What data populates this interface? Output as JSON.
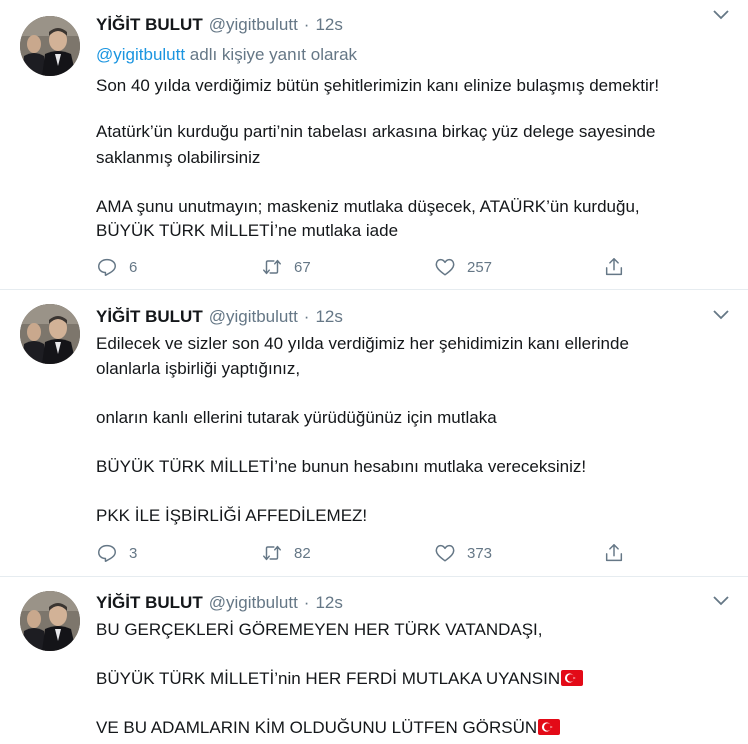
{
  "tweets": [
    {
      "name": "YİĞİT BULUT",
      "handle": "@yigitbulutt",
      "separator": "·",
      "time": "12s",
      "reply_to": {
        "mention": "@yigitbulutt",
        "text": " adlı kişiye yanıt olarak"
      },
      "lines": [
        "Son 40 yılda verdiğimiz bütün şehitlerimizin kanı elinize bulaşmış demektir!",
        "Atatürk’ün kurduğu parti’nin tabelası arkasına birkaç yüz delege sayesinde",
        "saklanmış olabilirsiniz",
        "AMA şunu unutmayın; maskeniz mutlaka düşecek, ATAÜRK’ün kurduğu,",
        "BÜYÜK TÜRK MİLLETİ’ne mutlaka iade"
      ],
      "replies": "6",
      "retweets": "67",
      "likes": "257"
    },
    {
      "name": "YİĞİT BULUT",
      "handle": "@yigitbulutt",
      "separator": "·",
      "time": "12s",
      "lines": [
        "Edilecek ve sizler son 40 yılda verdiğimiz her şehidimizin kanı ellerinde",
        "olanlarla işbirliği yaptığınız,",
        "onların kanlı ellerini tutarak yürüdüğünüz için mutlaka",
        "BÜYÜK TÜRK MİLLETİ’ne bunun hesabını mutlaka vereceksiniz!",
        "PKK İLE İŞBİRLİĞİ AFFEDİLEMEZ!"
      ],
      "replies": "3",
      "retweets": "82",
      "likes": "373"
    },
    {
      "name": "YİĞİT BULUT",
      "handle": "@yigitbulutt",
      "separator": "·",
      "time": "12s",
      "lines": [
        "BU GERÇEKLERİ GÖREMEYEN HER TÜRK VATANDAŞI,",
        "BÜYÜK TÜRK MİLLETİ’nin HER FERDİ MUTLAKA UYANSIN",
        "VE BU ADAMLARIN KİM OLDUĞUNU LÜTFEN GÖRSÜN"
      ]
    }
  ],
  "colors": {
    "text": "#14171a",
    "secondary": "#657786",
    "link": "#1b95e0",
    "divider": "#e6ecf0",
    "flag_red": "#e30a17"
  },
  "icons": [
    "caret-down-icon",
    "reply-icon",
    "retweet-icon",
    "like-icon",
    "share-icon",
    "turkish-flag-icon"
  ]
}
